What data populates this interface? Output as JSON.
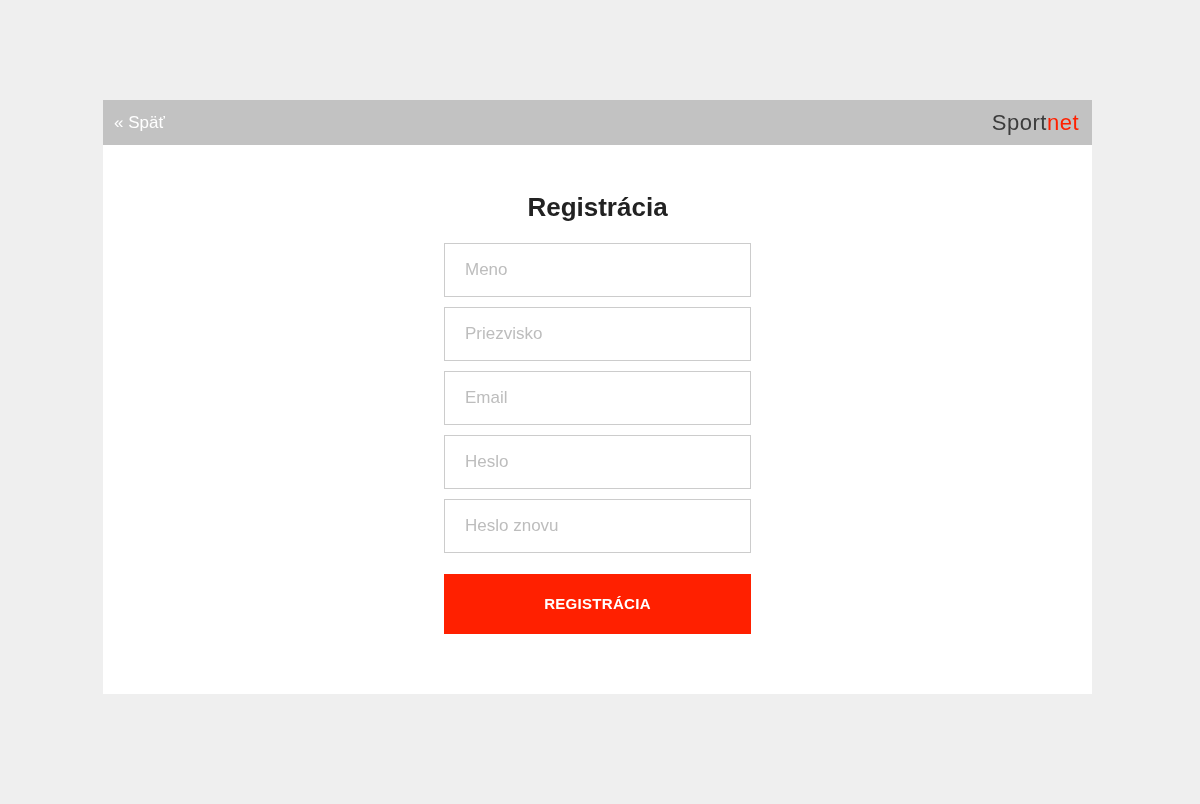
{
  "header": {
    "back_link": "« Späť",
    "logo": {
      "dark_part": "Sport",
      "accent_part": "net"
    }
  },
  "form": {
    "title": "Registrácia",
    "fields": [
      {
        "placeholder": "Meno"
      },
      {
        "placeholder": "Priezvisko"
      },
      {
        "placeholder": "Email"
      },
      {
        "placeholder": "Heslo"
      },
      {
        "placeholder": "Heslo znovu"
      }
    ],
    "submit_button": "REGISTRÁCIA"
  }
}
